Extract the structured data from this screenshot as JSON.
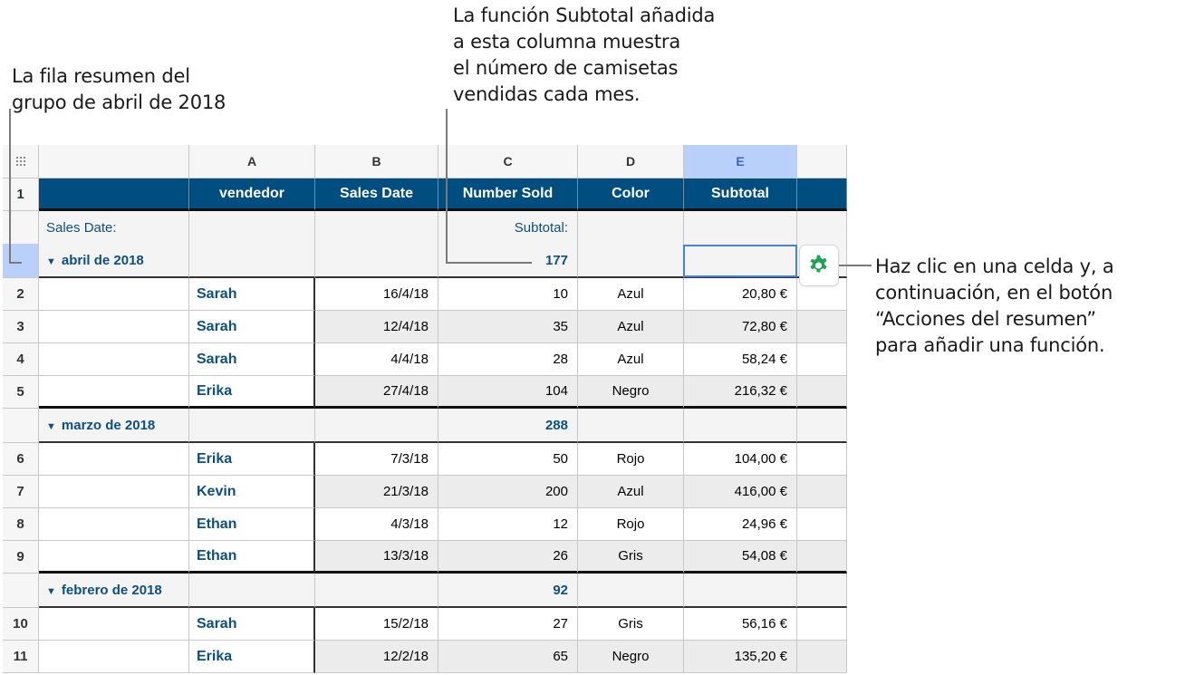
{
  "callouts": {
    "summary_row": "La fila resumen del\ngrupo de abril de 2018",
    "subtotal_function": "La función Subtotal añadida\na esta columna muestra\nel número de camisetas\nvendidas cada mes.",
    "summary_actions": "Haz clic en una celda y, a\ncontinuación, en el botón\n“Acciones del resumen”\npara añadir una función."
  },
  "table": {
    "column_letters": [
      "A",
      "B",
      "C",
      "D",
      "E"
    ],
    "selected_column": "E",
    "header_row_number": "1",
    "headers": [
      "vendedor",
      "Sales Date",
      "Number Sold",
      "Color",
      "Subtotal"
    ],
    "groups": [
      {
        "label": "abril de 2018",
        "group_by_label": "Sales Date:",
        "function_label": "Subtotal:",
        "subtotal": "177",
        "rows": [
          {
            "num": "2",
            "vendedor": "Sarah",
            "date": "16/4/18",
            "sold": "10",
            "color": "Azul",
            "subtotal": "20,80 €"
          },
          {
            "num": "3",
            "vendedor": "Sarah",
            "date": "12/4/18",
            "sold": "35",
            "color": "Azul",
            "subtotal": "72,80 €"
          },
          {
            "num": "4",
            "vendedor": "Sarah",
            "date": "4/4/18",
            "sold": "28",
            "color": "Azul",
            "subtotal": "58,24 €"
          },
          {
            "num": "5",
            "vendedor": "Erika",
            "date": "27/4/18",
            "sold": "104",
            "color": "Negro",
            "subtotal": "216,32 €"
          }
        ]
      },
      {
        "label": "marzo de 2018",
        "subtotal": "288",
        "rows": [
          {
            "num": "6",
            "vendedor": "Erika",
            "date": "7/3/18",
            "sold": "50",
            "color": "Rojo",
            "subtotal": "104,00 €"
          },
          {
            "num": "7",
            "vendedor": "Kevin",
            "date": "21/3/18",
            "sold": "200",
            "color": "Azul",
            "subtotal": "416,00 €"
          },
          {
            "num": "8",
            "vendedor": "Ethan",
            "date": "4/3/18",
            "sold": "12",
            "color": "Rojo",
            "subtotal": "24,96 €"
          },
          {
            "num": "9",
            "vendedor": "Ethan",
            "date": "13/3/18",
            "sold": "26",
            "color": "Gris",
            "subtotal": "54,08 €"
          }
        ]
      },
      {
        "label": "febrero de 2018",
        "subtotal": "92",
        "rows": [
          {
            "num": "10",
            "vendedor": "Sarah",
            "date": "15/2/18",
            "sold": "27",
            "color": "Gris",
            "subtotal": "56,16 €"
          },
          {
            "num": "11",
            "vendedor": "Erika",
            "date": "12/2/18",
            "sold": "65",
            "color": "Negro",
            "subtotal": "135,20 €"
          }
        ]
      }
    ]
  },
  "icons": {
    "table_handle": "grip-dots-icon",
    "gear": "summary-actions-gear-icon",
    "disclosure": "disclosure-triangle-icon"
  },
  "colors": {
    "header_fill": "#004e80",
    "group_text": "#0e4f82",
    "gear": "#1fa355",
    "selection": "#4a80d8"
  }
}
